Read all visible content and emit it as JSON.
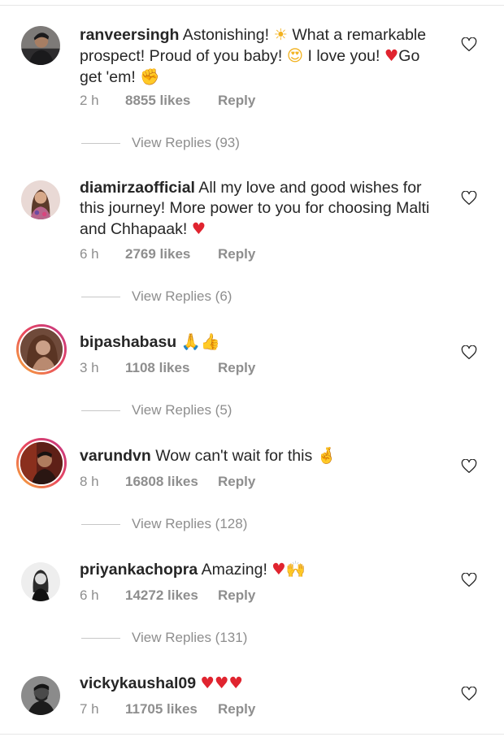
{
  "comments": [
    {
      "username": "ranveersingh",
      "segments": [
        {
          "t": " Astonishing! "
        },
        {
          "e": "☀",
          "c": "e-gold"
        },
        {
          "t": " What a remarkable prospect! Proud of you baby! "
        },
        {
          "e": "😍",
          "c": "e-gold"
        },
        {
          "t": " I love you! "
        },
        {
          "e": "♥",
          "c": "e-red"
        },
        {
          "t": "Go get 'em! "
        },
        {
          "e": "✊",
          "c": "e-skin"
        }
      ],
      "time": "2 h",
      "likes": "8855 likes",
      "reply": "Reply",
      "view_replies": "View Replies (93)",
      "avatar_ring": false
    },
    {
      "username": "diamirzaofficial",
      "segments": [
        {
          "t": " All my love and good wishes for this journey! More power to you for choosing Malti and Chhapaak! "
        },
        {
          "e": "♥",
          "c": "e-red"
        }
      ],
      "time": "6 h",
      "likes": "2769 likes",
      "reply": "Reply",
      "view_replies": "View Replies (6)",
      "avatar_ring": false
    },
    {
      "username": "bipashabasu",
      "segments": [
        {
          "t": " "
        },
        {
          "e": "🙏",
          "c": "e-gold"
        },
        {
          "e": "👍",
          "c": "e-light"
        }
      ],
      "time": "3 h",
      "likes": "1108 likes",
      "reply": "Reply",
      "view_replies": "View Replies (5)",
      "avatar_ring": true
    },
    {
      "username": "varundvn",
      "segments": [
        {
          "t": " Wow can't wait for this "
        },
        {
          "e": "🤞",
          "c": "e-light"
        }
      ],
      "time": "8 h",
      "likes": "16808 likes",
      "reply": "Reply",
      "view_replies": "View Replies (128)",
      "avatar_ring": true
    },
    {
      "username": "priyankachopra",
      "segments": [
        {
          "t": " Amazing! "
        },
        {
          "e": "♥",
          "c": "e-red"
        },
        {
          "e": "🙌",
          "c": "e-dark"
        }
      ],
      "time": "6 h",
      "likes": "14272 likes",
      "reply": "Reply",
      "view_replies": "View Replies (131)",
      "avatar_ring": false
    },
    {
      "username": "vickykaushal09",
      "segments": [
        {
          "t": " "
        },
        {
          "e": "♥♥♥",
          "c": "e-red"
        }
      ],
      "time": "7 h",
      "likes": "11705 likes",
      "reply": "Reply",
      "view_replies": "",
      "avatar_ring": false
    }
  ],
  "colors": {
    "text": "#262626",
    "muted": "#8e8e8e",
    "heart_red": "#e0242f"
  },
  "icons": {
    "like": "heart-outline-icon"
  }
}
